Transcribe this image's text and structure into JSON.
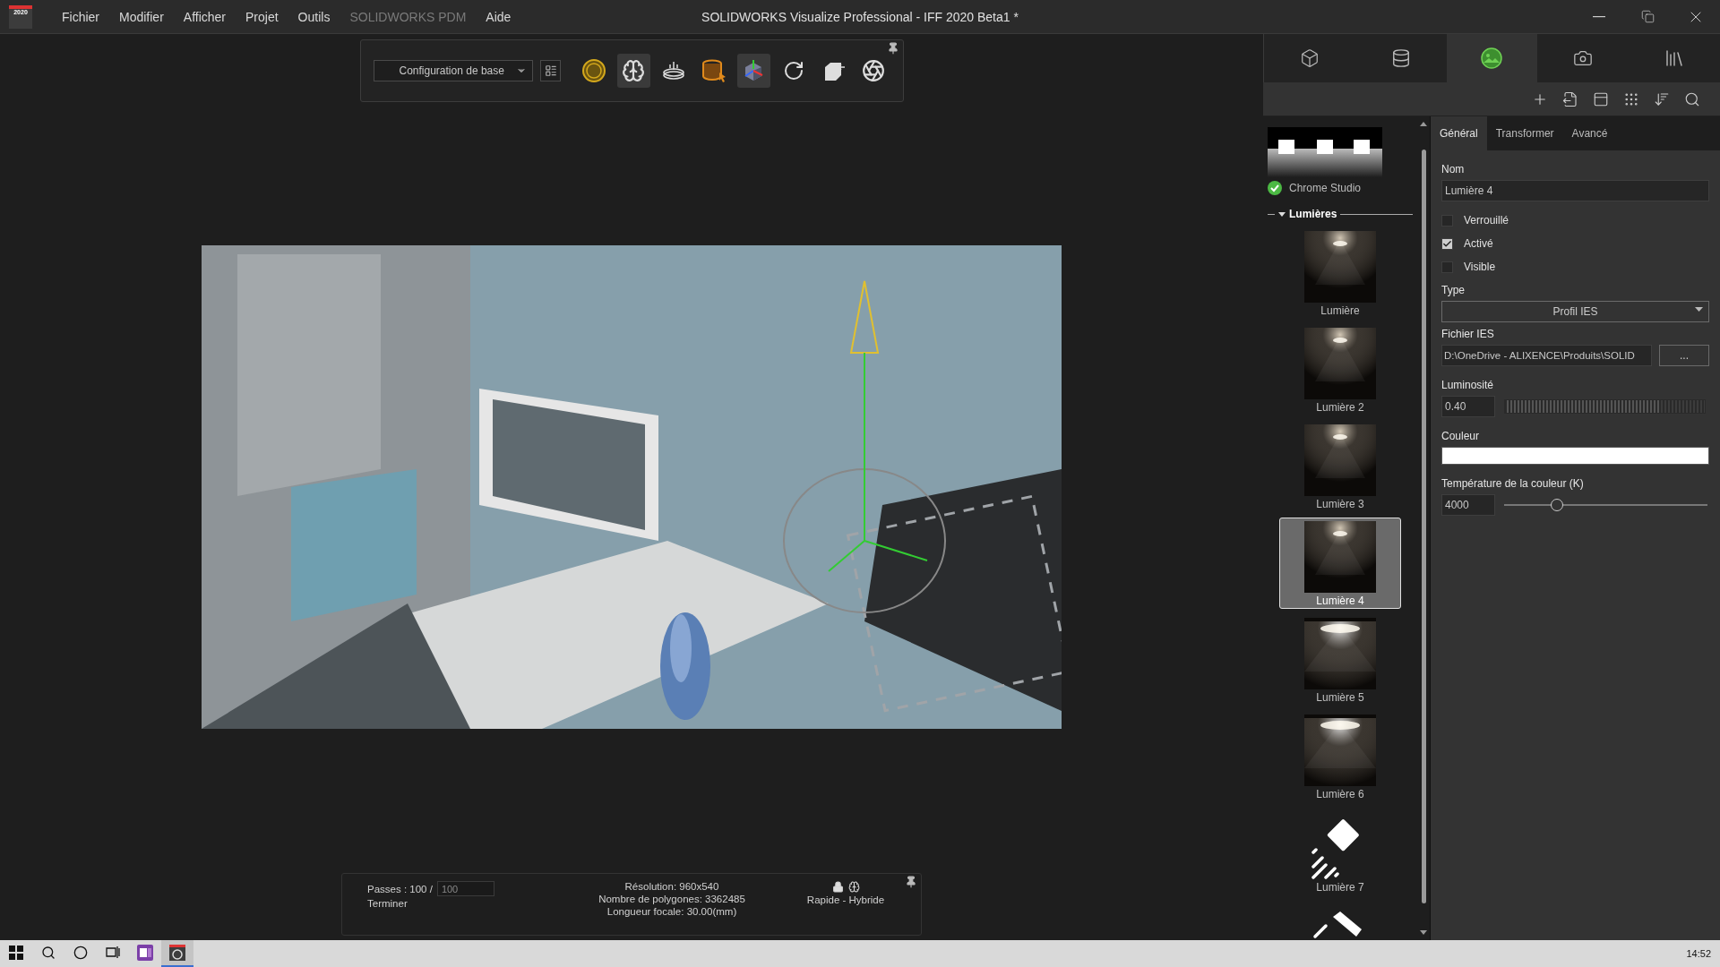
{
  "window": {
    "title": "SOLIDWORKS Visualize Professional - IFF 2020 Beta1 *",
    "logo_text": "2020"
  },
  "menu": [
    {
      "label": "Fichier",
      "disabled": false
    },
    {
      "label": "Modifier",
      "disabled": false
    },
    {
      "label": "Afficher",
      "disabled": false
    },
    {
      "label": "Projet",
      "disabled": false
    },
    {
      "label": "Outils",
      "disabled": false
    },
    {
      "label": "SOLIDWORKS PDM",
      "disabled": true
    },
    {
      "label": "Aide",
      "disabled": false
    }
  ],
  "toolbar": {
    "configuration": "Configuration de base",
    "tools": [
      {
        "kind": "sun",
        "selected": false
      },
      {
        "kind": "brain",
        "selected": true
      },
      {
        "kind": "turntable",
        "selected": false
      },
      {
        "kind": "bucket",
        "selected": false
      },
      {
        "kind": "cube",
        "selected": true
      },
      {
        "kind": "refresh",
        "selected": false
      },
      {
        "kind": "box",
        "selected": false
      },
      {
        "kind": "aperture",
        "selected": false
      }
    ]
  },
  "status": {
    "passes_label": "Passes : 100 /",
    "passes_max": "100",
    "state": "Terminer",
    "resolution": "Résolution: 960x540",
    "polygons": "Nombre de polygones: 3362485",
    "focal": "Longueur focale: 30.00(mm)",
    "mode": "Rapide - Hybride"
  },
  "panel_tabs": [
    {
      "kind": "model",
      "selected": false
    },
    {
      "kind": "appearance",
      "selected": false
    },
    {
      "kind": "scene",
      "selected": true
    },
    {
      "kind": "camera",
      "selected": false
    },
    {
      "kind": "library",
      "selected": false
    }
  ],
  "panel_tools": [
    {
      "kind": "add"
    },
    {
      "kind": "import"
    },
    {
      "kind": "layout"
    },
    {
      "kind": "grid"
    },
    {
      "kind": "sort"
    },
    {
      "kind": "search"
    }
  ],
  "environment": {
    "name": "Chrome Studio",
    "active": true
  },
  "lights_section": {
    "title": "Lumières",
    "expanded": true
  },
  "lights": [
    {
      "name": "Lumière",
      "kind": "spot",
      "selected": false
    },
    {
      "name": "Lumière 2",
      "kind": "spot",
      "selected": false
    },
    {
      "name": "Lumière 3",
      "kind": "spot",
      "selected": false
    },
    {
      "name": "Lumière 4",
      "kind": "spot",
      "selected": true
    },
    {
      "name": "Lumière 5",
      "kind": "wide",
      "selected": false
    },
    {
      "name": "Lumière 6",
      "kind": "wide",
      "selected": false
    },
    {
      "name": "Lumière 7",
      "kind": "directional",
      "selected": false
    },
    {
      "kind": "sun",
      "selected": false
    }
  ],
  "properties": {
    "tabs": [
      {
        "label": "Général",
        "selected": true
      },
      {
        "label": "Transformer",
        "selected": false
      },
      {
        "label": "Avancé",
        "selected": false
      }
    ],
    "name_label": "Nom",
    "name_value": "Lumière 4",
    "checks": [
      {
        "label": "Verrouillé",
        "checked": false
      },
      {
        "label": "Activé",
        "checked": true
      },
      {
        "label": "Visible",
        "checked": false
      }
    ],
    "type_label": "Type",
    "type_value": "Profil IES",
    "ies_label": "Fichier IES",
    "ies_value": "D:\\OneDrive - ALIXENCE\\Produits\\SOLID",
    "browse": "...",
    "brightness": {
      "label": "Luminosité",
      "value": "0.40",
      "level": 0.77
    },
    "color_label": "Couleur",
    "temperature": {
      "label": "Température de la couleur (K)",
      "value": "4000",
      "level": 0.26
    }
  },
  "taskbar": {
    "apps": [
      {
        "kind": "start",
        "selected": false
      },
      {
        "kind": "search",
        "selected": false
      },
      {
        "kind": "cortana",
        "selected": false
      },
      {
        "kind": "taskview",
        "selected": false
      },
      {
        "kind": "notes",
        "selected": false
      },
      {
        "kind": "visualize",
        "selected": true
      }
    ],
    "clock": "14:52"
  }
}
